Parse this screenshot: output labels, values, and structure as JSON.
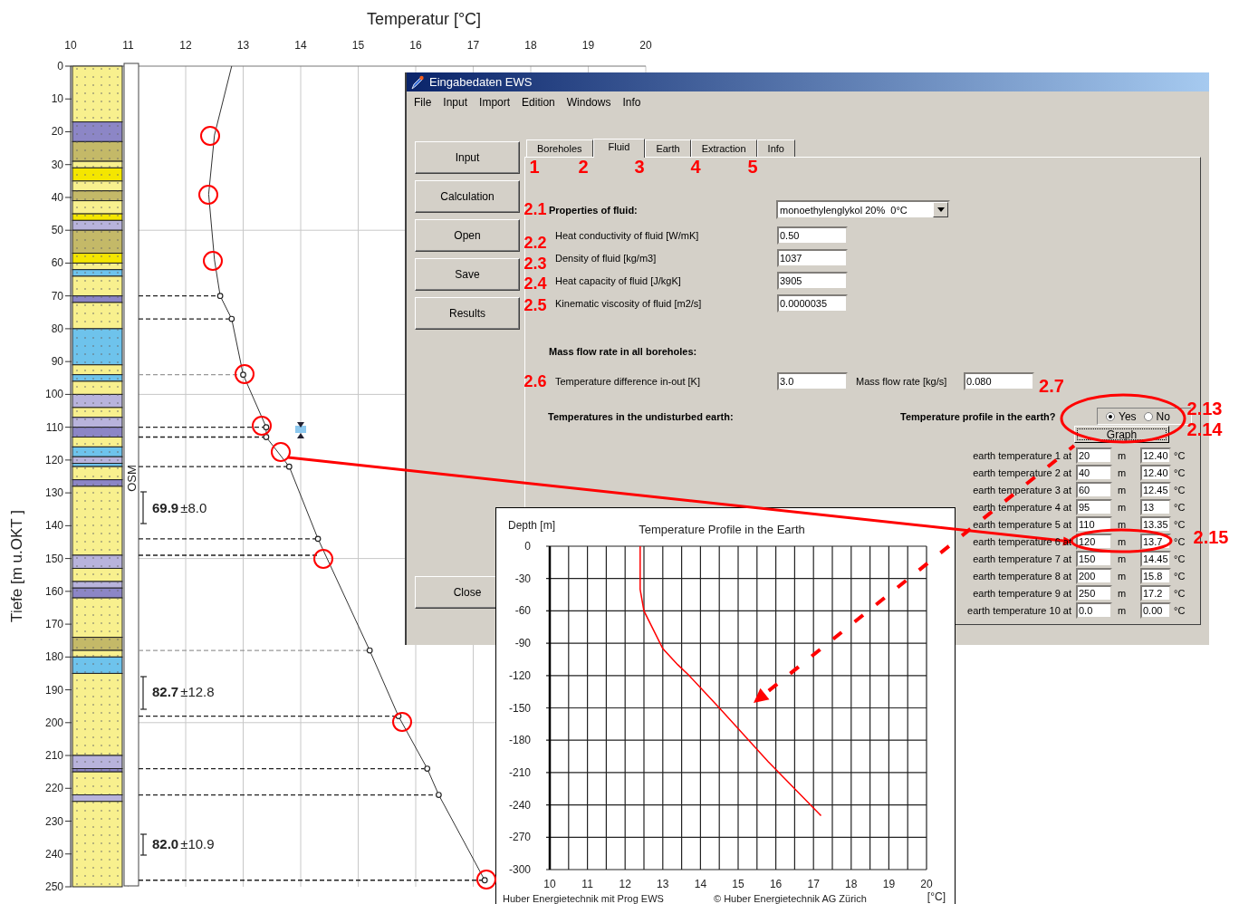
{
  "borehole_log": {
    "formation": "OSM",
    "intervals": [
      {
        "value": "69.9",
        "error": "±8.0"
      },
      {
        "value": "82.7",
        "error": "±12.8"
      },
      {
        "value": "82.0",
        "error": "±10.9"
      }
    ],
    "chart_data": {
      "type": "line",
      "xlabel": "Temperatur  [°C]",
      "ylabel": "Tiefe  [m u.OKT ]",
      "grid": true,
      "xlim": [
        10,
        20
      ],
      "ylim": [
        250,
        0
      ],
      "xticks": [
        10,
        11,
        12,
        13,
        14,
        15,
        16,
        17,
        18,
        19,
        20
      ],
      "yticks": [
        0,
        10,
        20,
        30,
        40,
        50,
        60,
        70,
        80,
        90,
        100,
        110,
        120,
        130,
        140,
        150,
        160,
        170,
        180,
        190,
        200,
        210,
        220,
        230,
        240,
        250
      ],
      "x": [
        12.8,
        12.5,
        12.4,
        12.5,
        12.6,
        12.8,
        13.0,
        13.4,
        13.4,
        13.8,
        14.3,
        15.2,
        15.7,
        16.2,
        16.4,
        17.2
      ],
      "series": [
        {
          "color": "#333333",
          "values": [
            0,
            21,
            39,
            59,
            70,
            77,
            94,
            110,
            113,
            122,
            144,
            178,
            198,
            214,
            222,
            248
          ]
        }
      ]
    }
  },
  "window": {
    "title": "Eingabedaten EWS",
    "menu": [
      "File",
      "Input",
      "Import",
      "Edition",
      "Windows",
      "Info"
    ],
    "side_buttons": [
      "Input",
      "Calculation",
      "Open",
      "Save",
      "Results"
    ],
    "close_button": "Close",
    "tabs": [
      {
        "label": "Boreholes",
        "selected": false
      },
      {
        "label": "Fluid",
        "selected": true
      },
      {
        "label": "Earth",
        "selected": false
      },
      {
        "label": "Extraction",
        "selected": false
      },
      {
        "label": "Info",
        "selected": false
      }
    ],
    "fluid": {
      "heading": "Properties of fluid:",
      "type": "monoethylenglykol 20%  0°C",
      "fields": [
        {
          "label": "Heat conductivity of fluid [W/mK]",
          "value": "0.50"
        },
        {
          "label": "Density of fluid [kg/m3]",
          "value": "1037"
        },
        {
          "label": "Heat capacity of fluid [J/kgK]",
          "value": "3905"
        },
        {
          "label": "Kinematic viscosity of fluid [m2/s]",
          "value": "0.0000035"
        }
      ]
    },
    "mass_flow": {
      "heading": "Mass flow rate in all boreholes:",
      "temp_diff_label": "Temperature difference in-out [K]",
      "temp_diff": "3.0",
      "rate_label": "Mass flow rate [kg/s]",
      "rate": "0.080"
    },
    "earth": {
      "heading": "Temperatures in the undisturbed earth:",
      "profile_question": "Temperature profile in the earth?",
      "profile_options": [
        {
          "label": "Yes",
          "selected": true
        },
        {
          "label": "No",
          "selected": false
        }
      ],
      "graph_button": "Graph",
      "rows": [
        {
          "label": "earth temperature 1 at",
          "depth": "20",
          "unit": "m",
          "temp": "12.40",
          "temp_unit": "°C"
        },
        {
          "label": "earth temperature 2 at",
          "depth": "40",
          "unit": "m",
          "temp": "12.40",
          "temp_unit": "°C"
        },
        {
          "label": "earth temperature 3 at",
          "depth": "60",
          "unit": "m",
          "temp": "12.45",
          "temp_unit": "°C"
        },
        {
          "label": "earth temperature 4 at",
          "depth": "95",
          "unit": "m",
          "temp": "13",
          "temp_unit": "°C"
        },
        {
          "label": "earth temperature 5 at",
          "depth": "110",
          "unit": "m",
          "temp": "13.35",
          "temp_unit": "°C"
        },
        {
          "label": "earth temperature 6 at",
          "depth": "120",
          "unit": "m",
          "temp": "13.7",
          "temp_unit": "°C"
        },
        {
          "label": "earth temperature 7 at",
          "depth": "150",
          "unit": "m",
          "temp": "14.45",
          "temp_unit": "°C"
        },
        {
          "label": "earth temperature 8 at",
          "depth": "200",
          "unit": "m",
          "temp": "15.8",
          "temp_unit": "°C"
        },
        {
          "label": "earth temperature 9 at",
          "depth": "250",
          "unit": "m",
          "temp": "17.2",
          "temp_unit": "°C"
        },
        {
          "label": "earth temperature 10 at",
          "depth": "0.0",
          "unit": "m",
          "temp": "0.00",
          "temp_unit": "°C"
        }
      ]
    }
  },
  "graph_window": {
    "footer": [
      "Huber Energietechnik mit Prog EWS",
      "© Huber Energietechnik AG  Zürich"
    ],
    "chart_data": {
      "type": "line",
      "title": "Temperature Profile in the Earth",
      "ylabel": "Depth [m]",
      "xlabel": "[°C]",
      "grid": true,
      "xlim": [
        10,
        20
      ],
      "ylim": [
        -300,
        0
      ],
      "xticks": [
        10,
        11,
        12,
        13,
        14,
        15,
        16,
        17,
        18,
        19,
        20
      ],
      "yticks": [
        0,
        -30,
        -60,
        -90,
        -120,
        -150,
        -180,
        -210,
        -240,
        -270,
        -300
      ],
      "x": [
        12.4,
        12.4,
        12.4,
        12.5,
        13.0,
        13.4,
        13.7,
        14.5,
        15.8,
        17.2
      ],
      "series": [
        {
          "color": "#ff0000",
          "values": [
            0,
            -20,
            -40,
            -60,
            -95,
            -110,
            -120,
            -150,
            -200,
            -250
          ]
        }
      ]
    }
  },
  "annotations": [
    {
      "label": "1"
    },
    {
      "label": "2"
    },
    {
      "label": "3"
    },
    {
      "label": "4"
    },
    {
      "label": "5"
    },
    {
      "label": "2.1"
    },
    {
      "label": "2.2"
    },
    {
      "label": "2.3"
    },
    {
      "label": "2.4"
    },
    {
      "label": "2.5"
    },
    {
      "label": "2.6"
    },
    {
      "label": "2.7"
    },
    {
      "label": "2.13"
    },
    {
      "label": "2.14"
    },
    {
      "label": "2.15"
    }
  ]
}
